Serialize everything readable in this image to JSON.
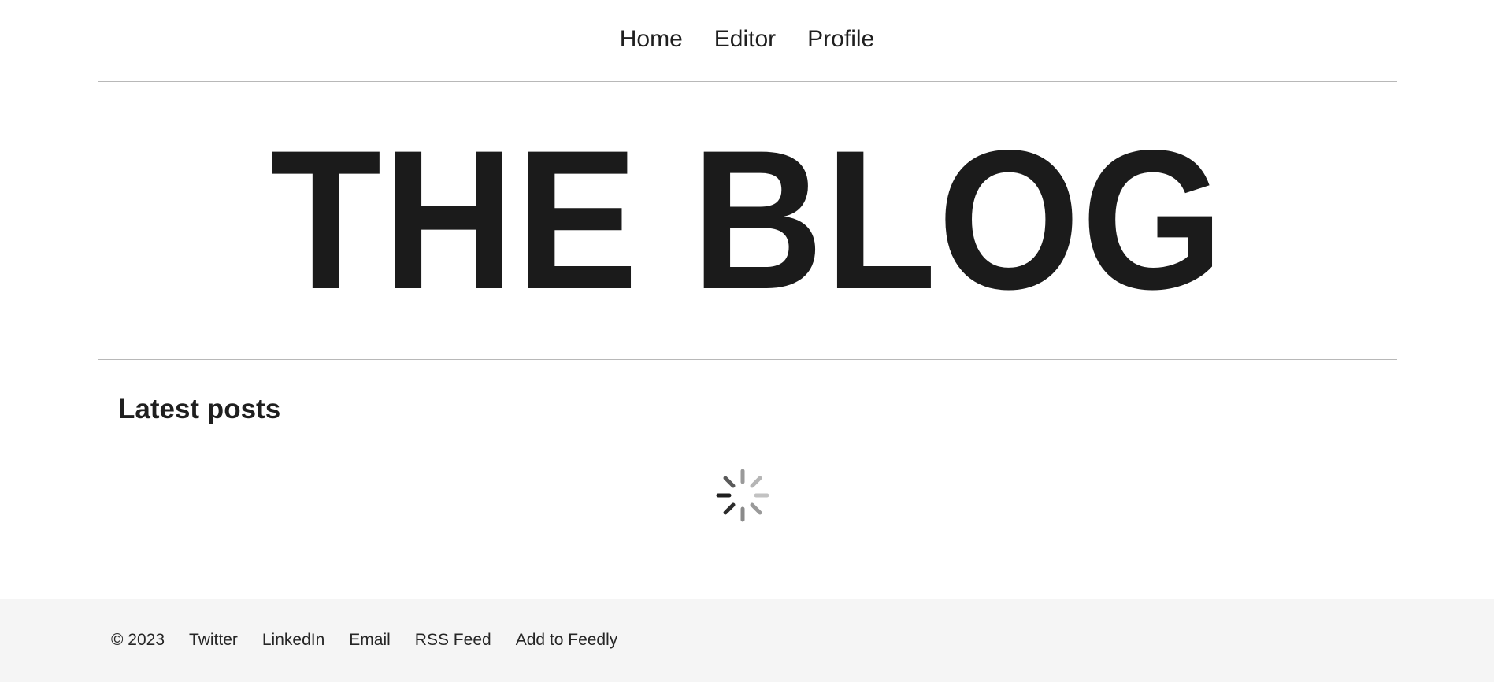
{
  "nav": {
    "items": [
      {
        "label": "Home",
        "active": true
      },
      {
        "label": "Editor",
        "active": false
      },
      {
        "label": "Profile",
        "active": false
      }
    ]
  },
  "hero": {
    "title": "THE BLOG"
  },
  "main": {
    "heading": "Latest posts",
    "loading_icon": "spinner-icon"
  },
  "footer": {
    "copyright": "© 2023",
    "links": [
      "Twitter",
      "LinkedIn",
      "Email",
      "RSS Feed",
      "Add to Feedly"
    ],
    "background": "#f5f5f5"
  }
}
